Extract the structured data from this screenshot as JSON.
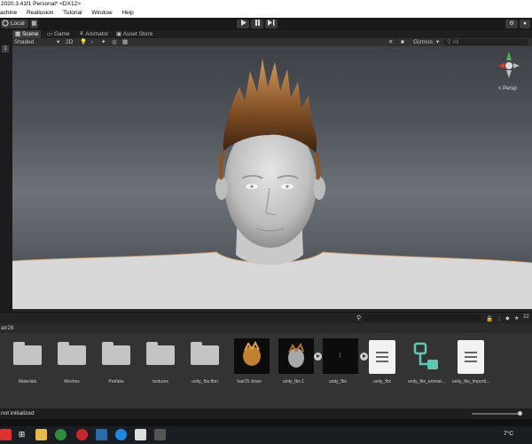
{
  "window": {
    "title": "2020.3.41f1 Personal* <DX12>"
  },
  "menu": {
    "items": [
      "achine",
      "Reallusion",
      "Tutorial",
      "Window",
      "Help"
    ]
  },
  "toolbar": {
    "pivot_label": "Local",
    "play": "play",
    "pause": "pause",
    "step": "step"
  },
  "tabs": [
    {
      "label": "Scene"
    },
    {
      "label": "Game"
    },
    {
      "label": "Animator"
    },
    {
      "label": "Asset Store"
    }
  ],
  "scene_tools": {
    "shading_mode": "Shaded",
    "mode_2d": "2D",
    "gizmos_label": "Gizmos",
    "search_placeholder": "All"
  },
  "gizmo": {
    "projection_label": "< Persp"
  },
  "project": {
    "breadcrumb": "air28",
    "assets": [
      {
        "label": "Materials",
        "kind": "folder"
      },
      {
        "label": "Meshes",
        "kind": "folder"
      },
      {
        "label": "Prefabs",
        "kind": "folder"
      },
      {
        "label": "textures",
        "kind": "folder"
      },
      {
        "label": "unity_fbx.fbm",
        "kind": "folder"
      },
      {
        "label": "hair25 clean",
        "kind": "preview"
      },
      {
        "label": "unity_fbx 1",
        "kind": "preview"
      },
      {
        "label": "unity_fbx",
        "kind": "preview"
      },
      {
        "label": "unity_fbx",
        "kind": "document"
      },
      {
        "label": "unity_fbx_animat...",
        "kind": "graph"
      },
      {
        "label": "unity_fbx_Importi...",
        "kind": "document"
      }
    ],
    "badge_count": "22"
  },
  "status": {
    "message": "not initialized"
  },
  "taskbar": {
    "temperature": "7°C"
  },
  "colors": {
    "accent": "#e8a33d",
    "panel": "#333333",
    "graph_icon": "#5fc8b5"
  }
}
